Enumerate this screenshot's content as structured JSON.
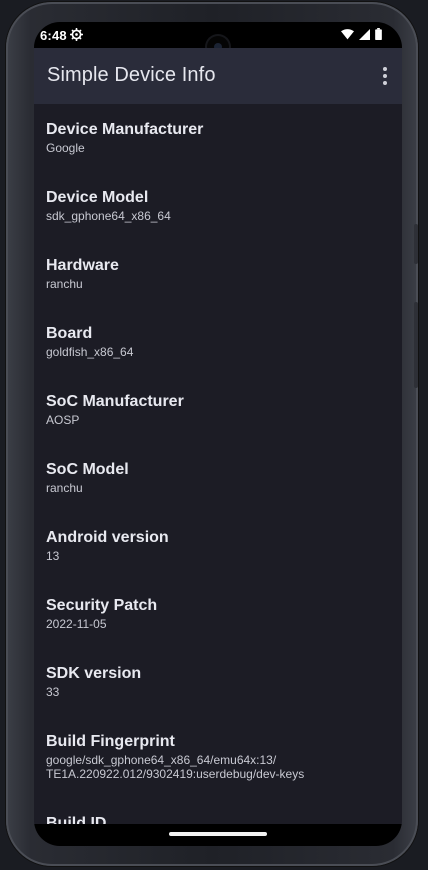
{
  "status_bar": {
    "time": "6:48",
    "settings_icon": "gear-icon",
    "wifi_icon": "wifi-icon",
    "signal_icon": "signal-icon",
    "battery_icon": "battery-icon"
  },
  "app_bar": {
    "title": "Simple Device Info",
    "menu_icon": "more-vert-icon"
  },
  "info_items": [
    {
      "label": "Device Manufacturer",
      "value": "Google"
    },
    {
      "label": "Device Model",
      "value": "sdk_gphone64_x86_64"
    },
    {
      "label": "Hardware",
      "value": "ranchu"
    },
    {
      "label": "Board",
      "value": "goldfish_x86_64"
    },
    {
      "label": "SoC Manufacturer",
      "value": "AOSP"
    },
    {
      "label": "SoC Model",
      "value": "ranchu"
    },
    {
      "label": "Android version",
      "value": "13"
    },
    {
      "label": "Security Patch",
      "value": "2022-11-05"
    },
    {
      "label": "SDK version",
      "value": "33"
    },
    {
      "label": "Build Fingerprint",
      "value_lines": [
        "google/sdk_gphone64_x86_64/emu64x:13/",
        "TE1A.220922.012/9302419:userdebug/dev-keys"
      ]
    },
    {
      "label": "Build ID",
      "value": ""
    }
  ],
  "colors": {
    "screen_bg": "#1c1c25",
    "app_bar_bg": "#2a2c3a",
    "text_primary": "#e8e9f0",
    "text_secondary": "#c8c9d2"
  }
}
